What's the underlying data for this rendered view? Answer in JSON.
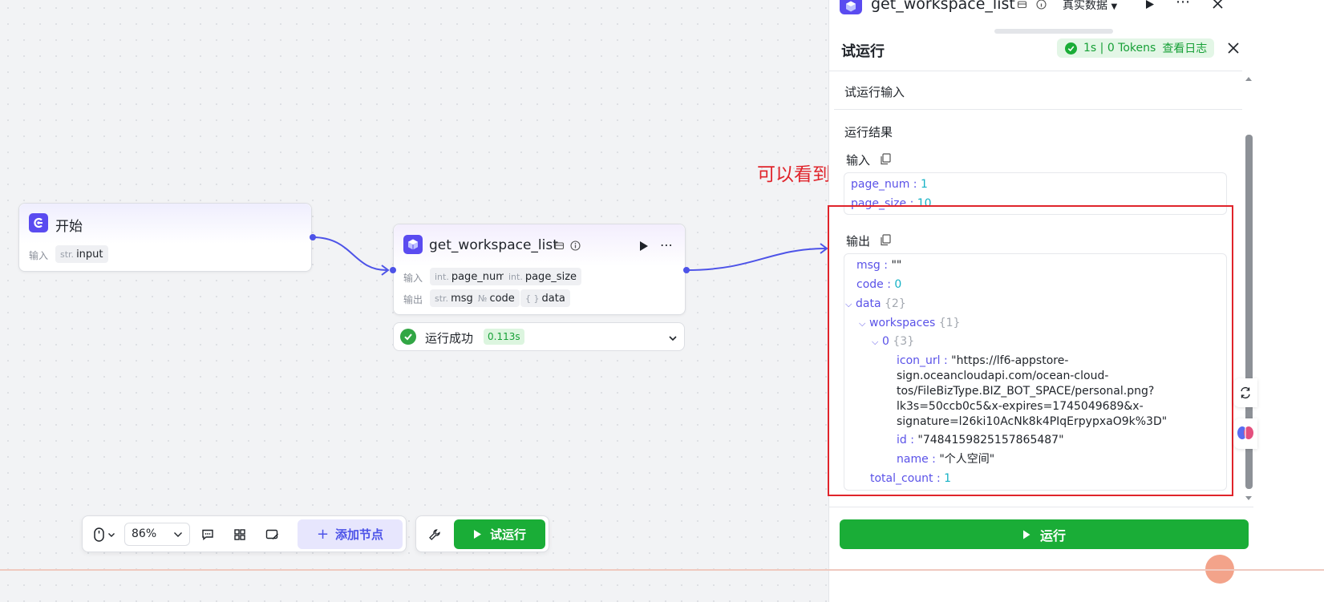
{
  "canvas": {
    "annotation": "可以看到运行成功",
    "start_node": {
      "title": "开始",
      "input_label": "输入",
      "inputs": [
        {
          "type": "str.",
          "name": "input"
        }
      ]
    },
    "tool_node": {
      "title": "get_workspace_list",
      "input_label": "输入",
      "output_label": "输出",
      "inputs": [
        {
          "type": "int.",
          "name": "page_num"
        },
        {
          "type": "int.",
          "name": "page_size"
        }
      ],
      "outputs": [
        {
          "type": "str.",
          "name": "msg"
        },
        {
          "type": "№",
          "name": "code"
        },
        {
          "type": "{ }",
          "name": "data"
        }
      ],
      "status_text": "运行成功",
      "duration": "0.113s"
    }
  },
  "toolbar": {
    "zoom": "86%",
    "add_node_label": "添加节点",
    "trial_run_label": "试运行"
  },
  "panel": {
    "header_node_title": "get_workspace_list",
    "data_source": "真实数据",
    "title": "试运行",
    "status_summary": "1s | 0 Tokens",
    "view_log": "查看日志",
    "input_section": "试运行输入",
    "result_section": "运行结果",
    "input_label": "输入",
    "output_label": "输出",
    "input_json": [
      {
        "key": "page_num",
        "value": "1"
      },
      {
        "key": "page_size",
        "value": "10"
      }
    ],
    "output_json": {
      "msg": "\"\"",
      "code": "0",
      "data_key": "data",
      "data_count": "{2}",
      "workspaces_key": "workspaces",
      "workspaces_count": "{1}",
      "item_index": "0",
      "item_count": "{3}",
      "icon_url_key": "icon_url",
      "icon_url_lines": [
        "\"https://lf6-appstore-",
        "sign.oceancloudapi.com/ocean-cloud-",
        "tos/FileBizType.BIZ_BOT_SPACE/personal.png?",
        "lk3s=50ccb0c5&x-expires=1745049689&x-",
        "signature=l26ki10AcNk8k4PIqErpypxaO9k%3D\""
      ],
      "id_key": "id",
      "id_value": "\"7484159825157865487\"",
      "name_key": "name",
      "name_value": "\"个人空间\"",
      "total_count_key": "total_count",
      "total_count_value": "1"
    },
    "run_label": "运行"
  },
  "colors": {
    "accent": "#4d53e8",
    "success": "#1aad37",
    "annotation": "#e0242b"
  }
}
